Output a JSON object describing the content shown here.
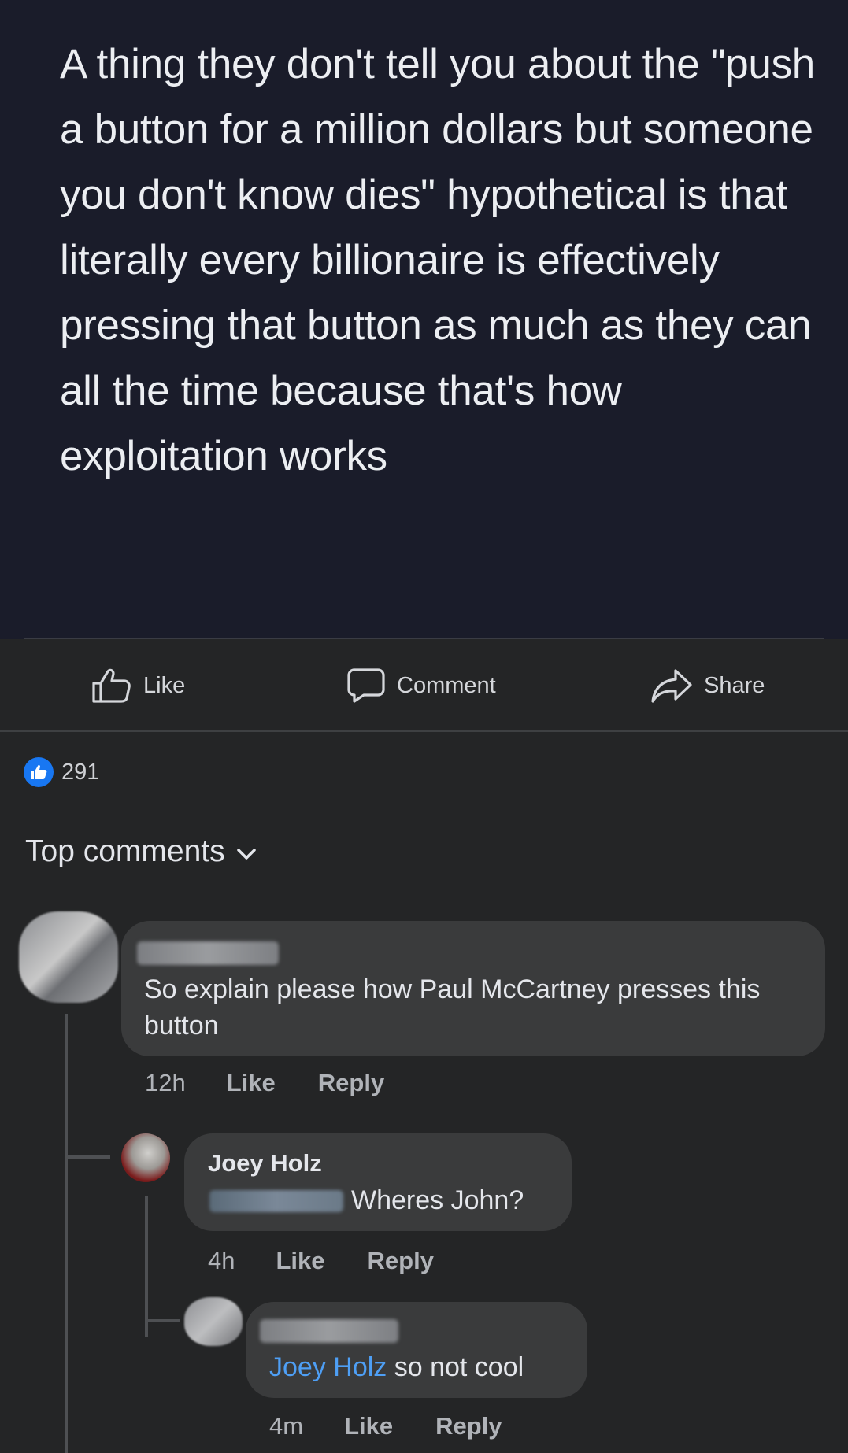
{
  "post": {
    "text": "A thing they don't tell you about the \"push a button for a million dollars but someone you don't know dies\" hypothetical is that literally every billionaire is effectively pressing that button as much as they can all the time because that's how exploitation works"
  },
  "actions": {
    "like_label": "Like",
    "comment_label": "Comment",
    "share_label": "Share"
  },
  "reactions": {
    "count": "291",
    "icon": "thumbs-up-icon"
  },
  "comments_header": {
    "label": "Top comments",
    "icon": "chevron-down-icon"
  },
  "comments": [
    {
      "text": "So explain please how Paul McCartney presses this button",
      "time": "12h",
      "like_label": "Like",
      "reply_label": "Reply"
    },
    {
      "author": "Joey Holz",
      "text": "Wheres John?",
      "time": "4h",
      "like_label": "Like",
      "reply_label": "Reply"
    },
    {
      "mention": "Joey Holz",
      "text": " so not cool",
      "time": "4m",
      "like_label": "Like",
      "reply_label": "Reply"
    }
  ],
  "colors": {
    "background": "#242526",
    "post_image_bg": "#1a1c2a",
    "bubble": "#3a3b3c",
    "accent": "#1877f2",
    "mention": "#4e9ff5"
  }
}
